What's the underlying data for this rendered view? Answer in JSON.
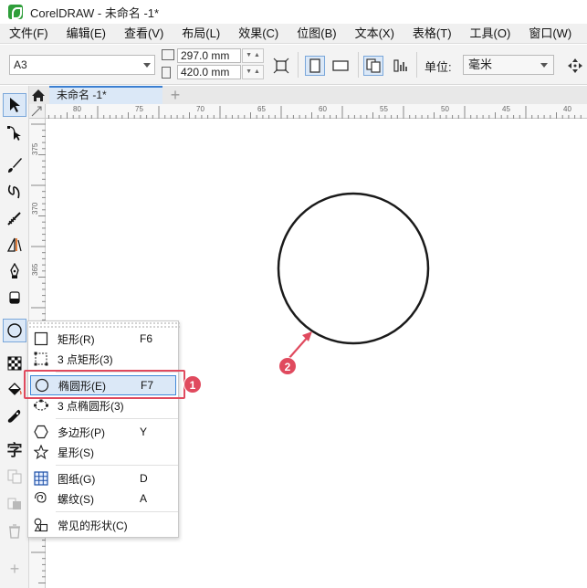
{
  "title": "CorelDRAW - 未命名 -1*",
  "menu": [
    "文件(F)",
    "编辑(E)",
    "查看(V)",
    "布局(L)",
    "效果(C)",
    "位图(B)",
    "文本(X)",
    "表格(T)",
    "工具(O)",
    "窗口(W)"
  ],
  "propbar": {
    "page_size": "A3",
    "width": "297.0 mm",
    "height": "420.0 mm",
    "unit_label": "单位:",
    "unit": "毫米"
  },
  "tabs": {
    "document": "未命名 -1*",
    "add": "+"
  },
  "ruler": {
    "h_labels": [
      "80",
      "75",
      "70",
      "65",
      "60",
      "55",
      "50",
      "45",
      "40"
    ],
    "v_labels": [
      "375",
      "370",
      "365"
    ]
  },
  "flyout": {
    "items": [
      {
        "label": "矩形(R)",
        "key": "F6",
        "icon": "rectangle-icon"
      },
      {
        "label": "3 点矩形(3)",
        "key": "",
        "icon": "3-point-rectangle-icon"
      },
      {
        "label": "椭圆形(E)",
        "key": "F7",
        "icon": "ellipse-icon"
      },
      {
        "label": "3 点椭圆形(3)",
        "key": "",
        "icon": "3-point-ellipse-icon"
      },
      {
        "label": "多边形(P)",
        "key": "Y",
        "icon": "polygon-icon"
      },
      {
        "label": "星形(S)",
        "key": "",
        "icon": "star-icon"
      },
      {
        "label": "图纸(G)",
        "key": "D",
        "icon": "graph-paper-icon"
      },
      {
        "label": "螺纹(S)",
        "key": "A",
        "icon": "spiral-icon"
      },
      {
        "label": "常见的形状(C)",
        "key": "",
        "icon": "common-shapes-icon"
      }
    ]
  },
  "callouts": [
    "1",
    "2"
  ],
  "colors": {
    "accent": "#3b7fd1",
    "callout": "#e04a5e",
    "highlight_bg": "#dbe8f7"
  }
}
